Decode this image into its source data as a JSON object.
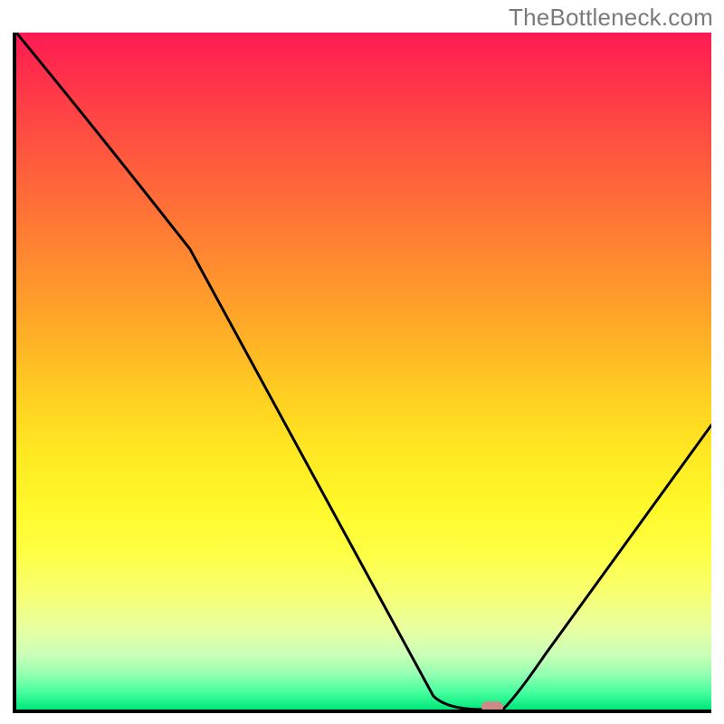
{
  "watermark": "TheBottleneck.com",
  "chart_data": {
    "type": "line",
    "title": "",
    "xlabel": "",
    "ylabel": "",
    "xlim": [
      0,
      100
    ],
    "ylim": [
      0,
      100
    ],
    "x": [
      0,
      25,
      60,
      67,
      70,
      100
    ],
    "values": [
      100,
      68,
      2,
      0,
      0,
      42
    ],
    "marker": {
      "x": 68.5,
      "y": 0
    },
    "annotations": [],
    "legend": []
  },
  "colors": {
    "axis": "#000000",
    "curve": "#000000",
    "marker": "#cf8a88",
    "gradient_top": "#ff1a52",
    "gradient_bottom": "#00e87b"
  }
}
